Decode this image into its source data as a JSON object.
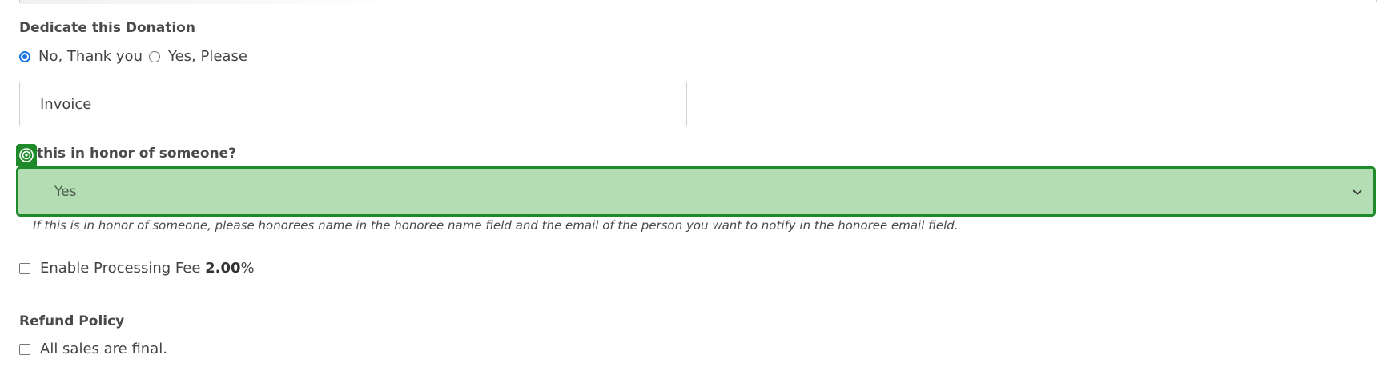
{
  "dedicate": {
    "heading": "Dedicate this Donation",
    "options": [
      {
        "label": "No, Thank you",
        "checked": true
      },
      {
        "label": "Yes, Please",
        "checked": false
      }
    ]
  },
  "invoice": {
    "value": "Invoice"
  },
  "honor": {
    "label": "this in honor of someone?",
    "selected": "Yes",
    "help": "If this is in honor of someone, please honorees name in the honoree name field and the email of the person you want to notify in the honoree email field."
  },
  "processing_fee": {
    "label": "Enable Processing Fee",
    "value": "2.00",
    "unit": "%",
    "checked": false
  },
  "refund": {
    "heading": "Refund Policy",
    "checkbox_label": "All sales are final.",
    "checked": false
  },
  "colors": {
    "highlight_border": "#1f8a2a",
    "highlight_fill": "#b3ddb3",
    "radio_accent": "#1a73e8"
  },
  "icons": {
    "target_badge": "target-icon",
    "select_chevron": "chevron-down-icon"
  }
}
